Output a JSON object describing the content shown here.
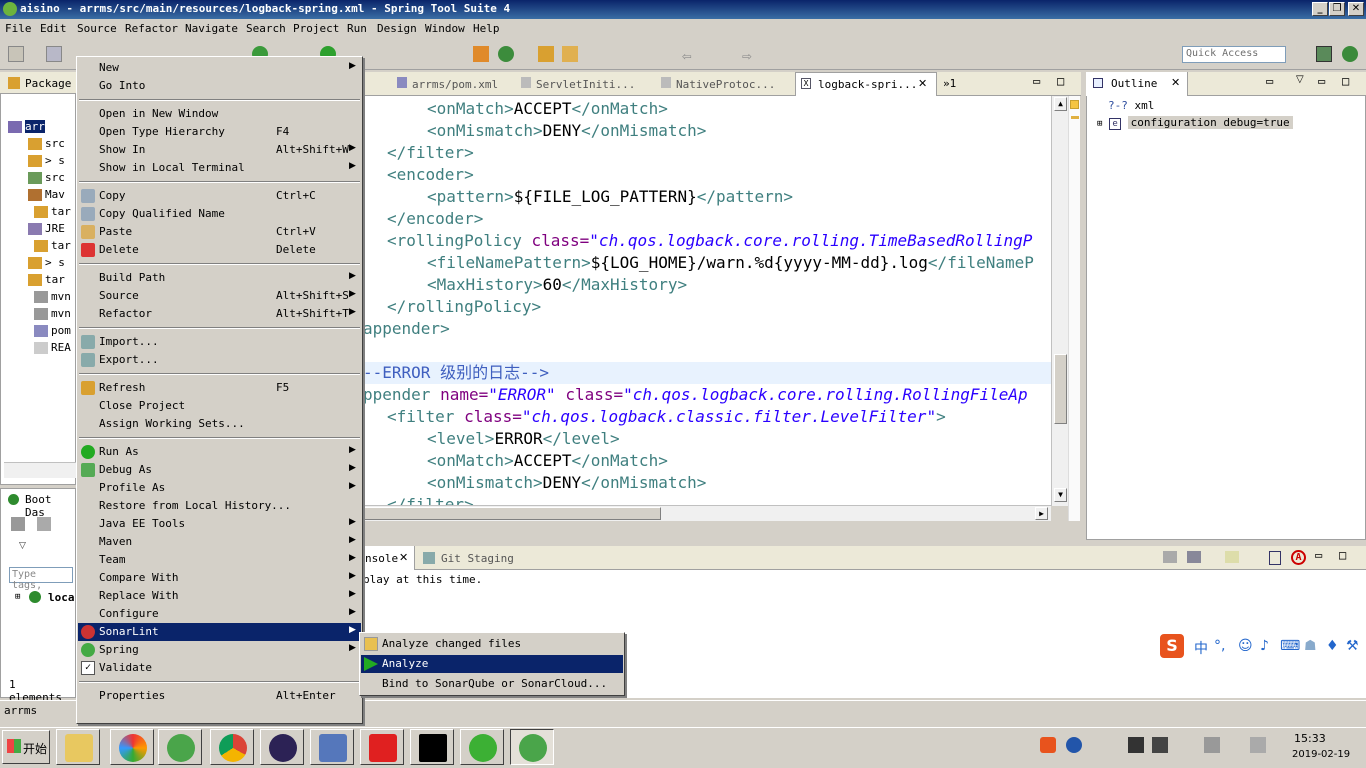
{
  "window": {
    "title": "aisino - arrms/src/main/resources/logback-spring.xml - Spring Tool Suite 4",
    "min": "_",
    "restore": "❐",
    "close": "✕"
  },
  "menubar": [
    "File",
    "Edit",
    "Source",
    "Refactor",
    "Navigate",
    "Search",
    "Project",
    "Run",
    "Design",
    "Window",
    "Help"
  ],
  "toolbar": {
    "quick_access_placeholder": "Quick Access"
  },
  "package_explorer": {
    "tab_label": "Package",
    "rows": [
      "arr",
      "src",
      "> s",
      "src",
      "Mav",
      "tar",
      "JRE",
      "tar",
      "> s",
      "tar",
      "mvn",
      "mvn",
      "pom",
      "REA"
    ]
  },
  "boot_dash": {
    "tab_label": "Boot Das",
    "filter_placeholder": "Type tags,",
    "item": "loca",
    "elements": "1 elements"
  },
  "editor": {
    "tabs": [
      "arrms/pom.xml",
      "ServletIniti...",
      "NativeProtoc...",
      "logback-spri..."
    ],
    "overflow": "»1",
    "lines": [
      {
        "indent": 64,
        "parts": [
          [
            "tag",
            "<onMatch>"
          ],
          [
            "tx",
            "ACCEPT"
          ],
          [
            "tag",
            "</onMatch>"
          ]
        ]
      },
      {
        "indent": 64,
        "parts": [
          [
            "tag",
            "<onMismatch>"
          ],
          [
            "tx",
            "DENY"
          ],
          [
            "tag",
            "</onMismatch>"
          ]
        ]
      },
      {
        "indent": 24,
        "parts": [
          [
            "tag",
            "</filter>"
          ]
        ]
      },
      {
        "indent": 24,
        "parts": [
          [
            "tag",
            "<encoder>"
          ]
        ]
      },
      {
        "indent": 64,
        "parts": [
          [
            "tag",
            "<pattern>"
          ],
          [
            "tx",
            "${FILE_LOG_PATTERN}"
          ],
          [
            "tag",
            "</pattern>"
          ]
        ]
      },
      {
        "indent": 24,
        "parts": [
          [
            "tag",
            "</encoder>"
          ]
        ]
      },
      {
        "indent": 24,
        "parts": [
          [
            "tag",
            "<rollingPolicy "
          ],
          [
            "at",
            "class="
          ],
          [
            "av",
            "\"ch.qos.logback.core.rolling.TimeBasedRollingP"
          ]
        ]
      },
      {
        "indent": 64,
        "parts": [
          [
            "tag",
            "<fileNamePattern>"
          ],
          [
            "tx",
            "${LOG_HOME}/warn.%d{yyyy-MM-dd}.log"
          ],
          [
            "tag",
            "</fileNameP"
          ]
        ]
      },
      {
        "indent": 64,
        "parts": [
          [
            "tag",
            "<MaxHistory>"
          ],
          [
            "tx",
            "60"
          ],
          [
            "tag",
            "</MaxHistory>"
          ]
        ]
      },
      {
        "indent": 24,
        "parts": [
          [
            "tag",
            "</rollingPolicy>"
          ]
        ]
      },
      {
        "indent": 0,
        "parts": [
          [
            "tag",
            "appender>"
          ]
        ]
      },
      {
        "indent": 0,
        "parts": [
          [
            "tx",
            ""
          ]
        ]
      },
      {
        "indent": 0,
        "hl": true,
        "parts": [
          [
            "cm",
            "--ERROR 级别的日志-->"
          ]
        ]
      },
      {
        "indent": 0,
        "parts": [
          [
            "tag",
            "ppender "
          ],
          [
            "at",
            "name="
          ],
          [
            "av",
            "\"ERROR\""
          ],
          [
            "tx",
            " "
          ],
          [
            "at",
            "class="
          ],
          [
            "av",
            "\"ch.qos.logback.core.rolling.RollingFileAp"
          ]
        ]
      },
      {
        "indent": 24,
        "parts": [
          [
            "tag",
            "<filter "
          ],
          [
            "at",
            "class="
          ],
          [
            "av",
            "\"ch.qos.logback.classic.filter.LevelFilter\""
          ],
          [
            "tag",
            ">"
          ]
        ]
      },
      {
        "indent": 64,
        "parts": [
          [
            "tag",
            "<level>"
          ],
          [
            "tx",
            "ERROR"
          ],
          [
            "tag",
            "</level>"
          ]
        ]
      },
      {
        "indent": 64,
        "parts": [
          [
            "tag",
            "<onMatch>"
          ],
          [
            "tx",
            "ACCEPT"
          ],
          [
            "tag",
            "</onMatch>"
          ]
        ]
      },
      {
        "indent": 64,
        "parts": [
          [
            "tag",
            "<onMismatch>"
          ],
          [
            "tx",
            "DENY"
          ],
          [
            "tag",
            "</onMismatch>"
          ]
        ]
      },
      {
        "indent": 24,
        "parts": [
          [
            "tag",
            "</filter>"
          ]
        ]
      }
    ]
  },
  "outline": {
    "tab_label": "Outline",
    "items": [
      "xml",
      "configuration debug=true"
    ]
  },
  "console": {
    "tabs": [
      "nsole",
      "Git Staging"
    ],
    "text": "play at this time."
  },
  "statusbar": {
    "left": "arrms"
  },
  "context_menu": {
    "items": [
      {
        "label": "New",
        "accel": "",
        "submenu": true
      },
      {
        "label": "Go Into",
        "accel": "",
        "submenu": false
      },
      {
        "sep": true
      },
      {
        "label": "Open in New Window",
        "accel": "",
        "submenu": false
      },
      {
        "label": "Open Type Hierarchy",
        "accel": "F4",
        "submenu": false
      },
      {
        "label": "Show In",
        "accel": "Alt+Shift+W",
        "submenu": true
      },
      {
        "label": "Show in Local Terminal",
        "accel": "",
        "submenu": true
      },
      {
        "sep": true
      },
      {
        "label": "Copy",
        "accel": "Ctrl+C",
        "submenu": false,
        "icon": "copy-icon"
      },
      {
        "label": "Copy Qualified Name",
        "accel": "",
        "submenu": false,
        "icon": "copy-qualified-icon"
      },
      {
        "label": "Paste",
        "accel": "Ctrl+V",
        "submenu": false,
        "icon": "paste-icon"
      },
      {
        "label": "Delete",
        "accel": "Delete",
        "submenu": false,
        "icon": "delete-icon"
      },
      {
        "sep": true
      },
      {
        "label": "Build Path",
        "accel": "",
        "submenu": true
      },
      {
        "label": "Source",
        "accel": "Alt+Shift+S",
        "submenu": true
      },
      {
        "label": "Refactor",
        "accel": "Alt+Shift+T",
        "submenu": true
      },
      {
        "sep": true
      },
      {
        "label": "Import...",
        "accel": "",
        "submenu": false,
        "icon": "import-icon"
      },
      {
        "label": "Export...",
        "accel": "",
        "submenu": false,
        "icon": "export-icon"
      },
      {
        "sep": true
      },
      {
        "label": "Refresh",
        "accel": "F5",
        "submenu": false,
        "icon": "refresh-icon"
      },
      {
        "label": "Close Project",
        "accel": "",
        "submenu": false
      },
      {
        "label": "Assign Working Sets...",
        "accel": "",
        "submenu": false
      },
      {
        "sep": true
      },
      {
        "label": "Run As",
        "accel": "",
        "submenu": true,
        "icon": "run-icon"
      },
      {
        "label": "Debug As",
        "accel": "",
        "submenu": true,
        "icon": "debug-icon"
      },
      {
        "label": "Profile As",
        "accel": "",
        "submenu": true
      },
      {
        "label": "Restore from Local History...",
        "accel": "",
        "submenu": false
      },
      {
        "label": "Java EE Tools",
        "accel": "",
        "submenu": true
      },
      {
        "label": "Maven",
        "accel": "",
        "submenu": true
      },
      {
        "label": "Team",
        "accel": "",
        "submenu": true
      },
      {
        "label": "Compare With",
        "accel": "",
        "submenu": true
      },
      {
        "label": "Replace With",
        "accel": "",
        "submenu": true
      },
      {
        "label": "Configure",
        "accel": "",
        "submenu": true
      },
      {
        "label": "SonarLint",
        "accel": "",
        "submenu": true,
        "icon": "sonarlint-icon",
        "selected": true
      },
      {
        "label": "Spring",
        "accel": "",
        "submenu": true,
        "icon": "spring-icon"
      },
      {
        "label": "Validate",
        "accel": "",
        "submenu": false,
        "icon": "check-icon"
      },
      {
        "sep": true
      },
      {
        "label": "Properties",
        "accel": "Alt+Enter",
        "submenu": false
      }
    ]
  },
  "submenu": {
    "items": [
      {
        "label": "Analyze changed files",
        "icon": "analyze-changed-icon"
      },
      {
        "label": "Analyze",
        "icon": "analyze-icon",
        "selected": true
      },
      {
        "label": "Bind to SonarQube or SonarCloud...",
        "icon": ""
      }
    ]
  },
  "taskbar": {
    "start": "开始",
    "clock_time": "15:33",
    "clock_date": "2019-02-19"
  }
}
